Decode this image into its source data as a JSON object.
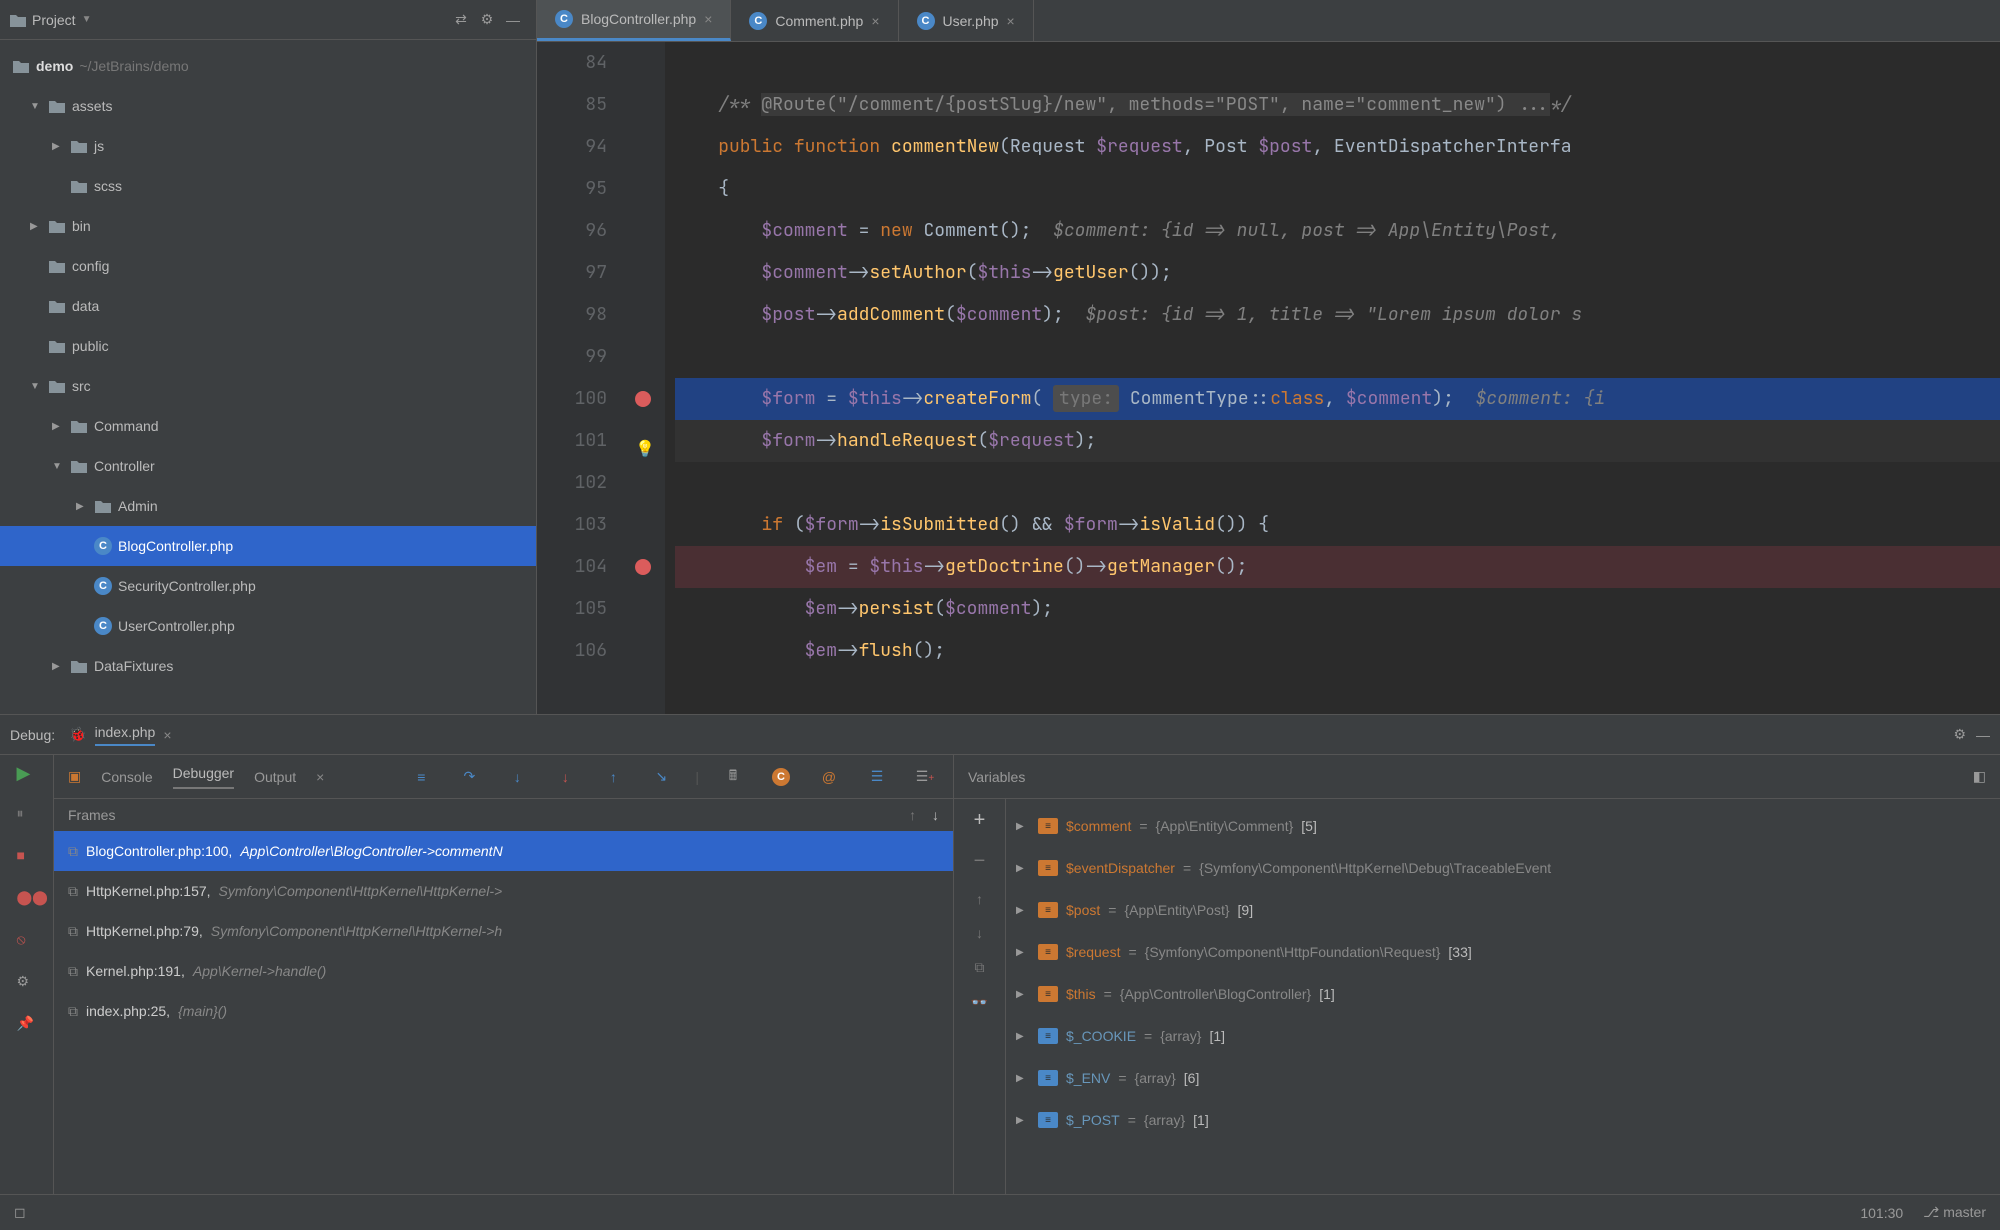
{
  "sidebar": {
    "title": "Project",
    "rootName": "demo",
    "rootPath": "~/JetBrains/demo",
    "tree": [
      {
        "level": 1,
        "arrow": "▼",
        "icon": "folder",
        "label": "assets"
      },
      {
        "level": 2,
        "arrow": "▶",
        "icon": "folder",
        "label": "js"
      },
      {
        "level": 2,
        "arrow": "",
        "icon": "folder",
        "label": "scss"
      },
      {
        "level": 1,
        "arrow": "▶",
        "icon": "folder",
        "label": "bin"
      },
      {
        "level": 1,
        "arrow": "",
        "icon": "folder",
        "label": "config"
      },
      {
        "level": 1,
        "arrow": "",
        "icon": "folder",
        "label": "data"
      },
      {
        "level": 1,
        "arrow": "",
        "icon": "folder",
        "label": "public"
      },
      {
        "level": 1,
        "arrow": "▼",
        "icon": "folder",
        "label": "src"
      },
      {
        "level": 2,
        "arrow": "▶",
        "icon": "folder",
        "label": "Command"
      },
      {
        "level": 2,
        "arrow": "▼",
        "icon": "folder",
        "label": "Controller"
      },
      {
        "level": 3,
        "arrow": "▶",
        "icon": "folder",
        "label": "Admin"
      },
      {
        "level": 3,
        "arrow": "",
        "icon": "php",
        "label": "BlogController.php",
        "sel": true
      },
      {
        "level": 3,
        "arrow": "",
        "icon": "php",
        "label": "SecurityController.php"
      },
      {
        "level": 3,
        "arrow": "",
        "icon": "php",
        "label": "UserController.php"
      },
      {
        "level": 2,
        "arrow": "▶",
        "icon": "folder",
        "label": "DataFixtures"
      }
    ]
  },
  "tabs": [
    {
      "label": "BlogController.php",
      "active": true
    },
    {
      "label": "Comment.php",
      "active": false
    },
    {
      "label": "User.php",
      "active": false
    }
  ],
  "gutterLines": [
    "84",
    "85",
    "94",
    "95",
    "96",
    "97",
    "98",
    "99",
    "100",
    "101",
    "102",
    "103",
    "104",
    "105",
    "106"
  ],
  "breakpoints": {
    "100": true,
    "104": true
  },
  "bulbLine": "101",
  "code": {
    "l1": "",
    "l2": {
      "pre": "    /** ",
      "doc": "@Route(\"/comment/{postSlug}/new\", methods=\"POST\", name=\"comment_new\") ...",
      "post": "*/"
    },
    "l3": {
      "a": "    public function ",
      "fn": "commentNew",
      "b": "(Request ",
      "v1": "$request",
      "c": ", Post ",
      "v2": "$post",
      "d": ", EventDispatcherInterfa"
    },
    "l4": "    {",
    "l5": {
      "a": "        ",
      "v": "$comment",
      "b": " = ",
      "kw": "new",
      "c": " Comment();  ",
      "cm": "$comment: {id => null, post => App\\Entity\\Post, "
    },
    "l6": {
      "a": "        ",
      "v": "$comment",
      "b": "->",
      "fn": "setAuthor",
      "c": "(",
      "v2": "$this",
      "d": "->",
      "fn2": "getUser",
      "e": "());"
    },
    "l7": {
      "a": "        ",
      "v": "$post",
      "b": "->",
      "fn": "addComment",
      "c": "(",
      "v2": "$comment",
      "d": ");  ",
      "cm": "$post: {id => 1, title => \"Lorem ipsum dolor s"
    },
    "l8": "",
    "l9": {
      "a": "        ",
      "v": "$form",
      "b": " = ",
      "v2": "$this",
      "c": "->",
      "fn": "createForm",
      "d": "( ",
      "hint": "type:",
      "e": " CommentType::",
      "kw": "class",
      "f": ", ",
      "v3": "$comment",
      "g": ");  ",
      "cm": "$comment: {i"
    },
    "l10": {
      "a": "        ",
      "v": "$form",
      "b": "->",
      "fn": "handleRequest",
      "c": "(",
      "v2": "$request",
      "d": ");"
    },
    "l11": "",
    "l12": {
      "a": "        ",
      "kw": "if ",
      "b": "(",
      "v": "$form",
      "c": "->",
      "fn": "isSubmitted",
      "d": "() && ",
      "v2": "$form",
      "e": "->",
      "fn2": "isValid",
      "f": "()) {"
    },
    "l13": {
      "a": "            ",
      "v": "$em",
      "b": " = ",
      "v2": "$this",
      "c": "->",
      "fn": "getDoctrine",
      "d": "()->",
      "fn2": "getManager",
      "e": "();"
    },
    "l14": {
      "a": "            ",
      "v": "$em",
      "b": "->",
      "fn": "persist",
      "c": "(",
      "v2": "$comment",
      "d": ");"
    },
    "l15": {
      "a": "            ",
      "v": "$em",
      "b": "->",
      "fn": "flush",
      "c": "();"
    }
  },
  "debugPanel": {
    "title": "Debug:",
    "tabName": "index.php",
    "subTabs": [
      "Console",
      "Debugger",
      "Output"
    ],
    "activeSubTab": "Debugger",
    "framesTitle": "Frames",
    "varsTitle": "Variables",
    "frames": [
      {
        "loc": "BlogController.php:100,",
        "cls": "App\\Controller\\BlogController->commentN",
        "sel": true
      },
      {
        "loc": "HttpKernel.php:157,",
        "cls": "Symfony\\Component\\HttpKernel\\HttpKernel->"
      },
      {
        "loc": "HttpKernel.php:79,",
        "cls": "Symfony\\Component\\HttpKernel\\HttpKernel->h"
      },
      {
        "loc": "Kernel.php:191,",
        "cls": "App\\Kernel->handle()"
      },
      {
        "loc": "index.php:25,",
        "cls": "{main}()"
      }
    ],
    "vars": [
      {
        "name": "$comment",
        "val": "{App\\Entity\\Comment}",
        "count": "[5]",
        "type": "obj"
      },
      {
        "name": "$eventDispatcher",
        "val": "{Symfony\\Component\\HttpKernel\\Debug\\TraceableEvent",
        "count": "",
        "type": "obj"
      },
      {
        "name": "$post",
        "val": "{App\\Entity\\Post}",
        "count": "[9]",
        "type": "obj"
      },
      {
        "name": "$request",
        "val": "{Symfony\\Component\\HttpFoundation\\Request}",
        "count": "[33]",
        "type": "obj"
      },
      {
        "name": "$this",
        "val": "{App\\Controller\\BlogController}",
        "count": "[1]",
        "type": "obj"
      },
      {
        "name": "$_COOKIE",
        "val": "{array}",
        "count": "[1]",
        "type": "arr"
      },
      {
        "name": "$_ENV",
        "val": "{array}",
        "count": "[6]",
        "type": "arr"
      },
      {
        "name": "$_POST",
        "val": "{array}",
        "count": "[1]",
        "type": "arr"
      }
    ]
  },
  "status": {
    "cursor": "101:30",
    "branch": "master"
  }
}
